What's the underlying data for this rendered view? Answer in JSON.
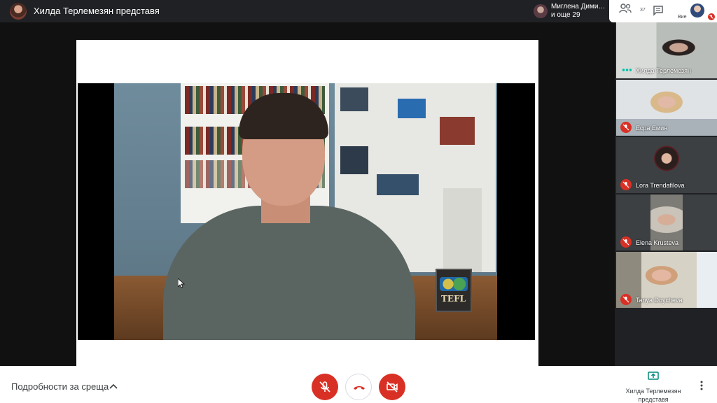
{
  "header": {
    "presenting_title": "Хилда Терлемезян представя",
    "participant_chip": {
      "line1": "Миглена Дими…",
      "line2": "и още 29"
    },
    "people_count": "37",
    "self_label": "Вие"
  },
  "stage": {
    "slide_sign_text": "TEFL"
  },
  "tiles": [
    {
      "name": "Хилда Терлемезян",
      "state": "speaking"
    },
    {
      "name": "Есра Емин",
      "state": "muted"
    },
    {
      "name": "Lora Trendafilova",
      "state": "muted"
    },
    {
      "name": "Elena Krusteva",
      "state": "muted"
    },
    {
      "name": "Tanya Doycheva",
      "state": "muted"
    }
  ],
  "footer": {
    "meeting_details": "Подробности за среща",
    "present_line1": "Хилда Терлемезян",
    "present_line2": "представя"
  },
  "colors": {
    "danger": "#d93025",
    "dark_bg": "#202124",
    "accent_teal": "#00897b"
  },
  "icons": [
    "people-icon",
    "chat-icon",
    "mic-off-icon",
    "call-end-icon",
    "videocam-off-icon",
    "present-icon",
    "more-vert-icon",
    "chevron-up-icon"
  ]
}
